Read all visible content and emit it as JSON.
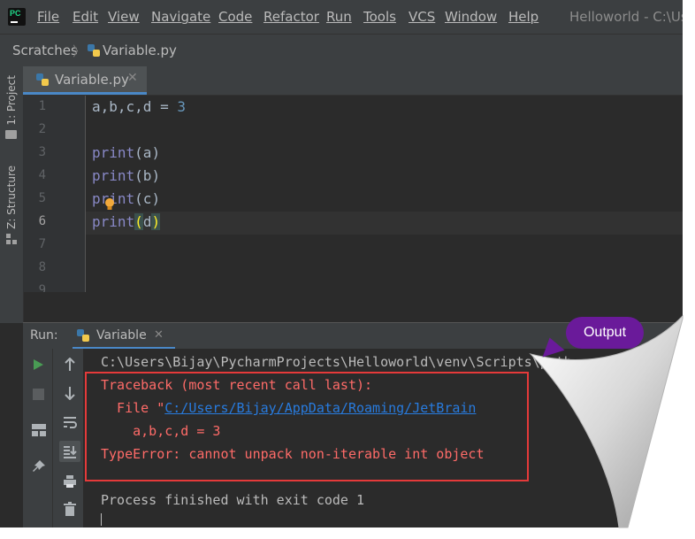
{
  "menubar": {
    "items": [
      "File",
      "Edit",
      "View",
      "Navigate",
      "Code",
      "Refactor",
      "Run",
      "Tools",
      "VCS",
      "Window",
      "Help"
    ],
    "window_title": "Helloworld - C:\\Use"
  },
  "breadcrumb": {
    "root": "Scratches",
    "file": "Variable.py"
  },
  "sidebar": {
    "project": "1: Project",
    "structure": "Z: Structure"
  },
  "editor": {
    "tab_label": "Variable.py",
    "line_numbers": [
      "1",
      "2",
      "3",
      "4",
      "5",
      "6",
      "7",
      "8"
    ],
    "lines": {
      "l1_vars": "a,b,c,d = ",
      "l1_num": "3",
      "l3_fn": "print",
      "l3_args": "(a)",
      "l4_fn": "print",
      "l4_args": "(b)",
      "l5_fn": "print",
      "l5_args": "(c)",
      "l6_fn": "print",
      "l6_open": "(",
      "l6_arg": "d",
      "l6_close": ")"
    }
  },
  "run": {
    "label": "Run:",
    "tab_label": "Variable",
    "console": {
      "cmd": "C:\\Users\\Bijay\\PycharmProjects\\Helloworld\\venv\\Scripts\\pyth",
      "traceback": "Traceback (most recent call last):",
      "file_prefix": "  File \"",
      "file_link": "C:/Users/Bijay/AppData/Roaming/JetBrain",
      "code_line": "    a,b,c,d = 3",
      "error": "TypeError: cannot unpack non-iterable int object",
      "finished": "Process finished with exit code 1"
    }
  },
  "annotation": {
    "callout": "Output"
  },
  "colors": {
    "accent": "#4a88c7",
    "error": "#ff6b68",
    "callout": "#6a1a9a",
    "highlight_box": "#e53a3a"
  }
}
